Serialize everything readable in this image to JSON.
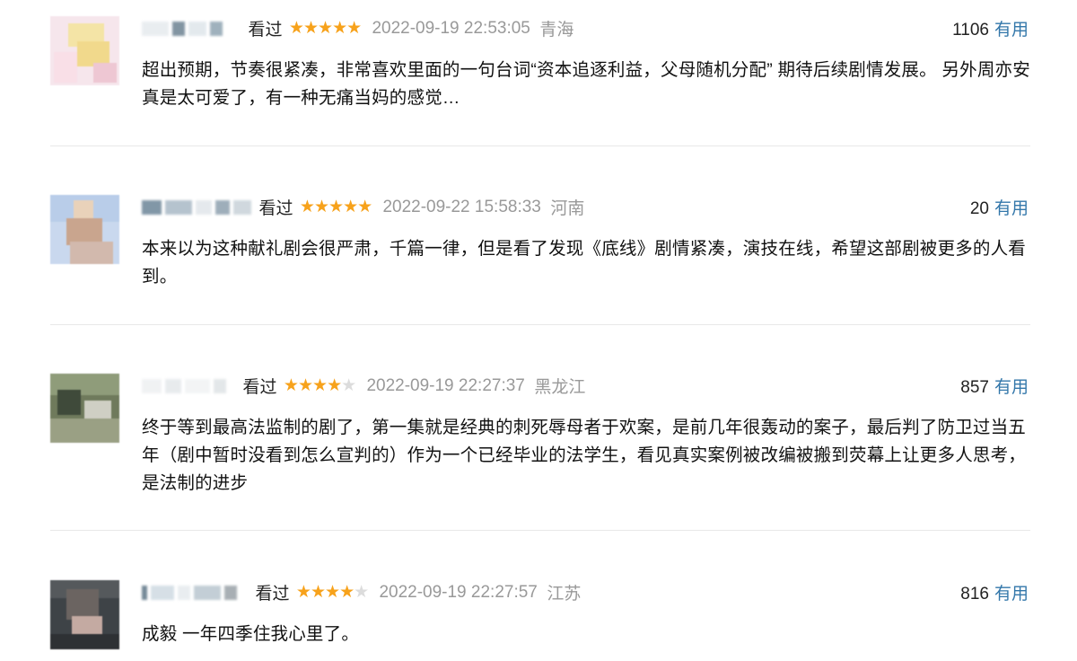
{
  "reviews": [
    {
      "status": "看过",
      "rating": 5,
      "time": "2022-09-19 22:53:05",
      "location": "青海",
      "useful_count": "1106",
      "useful_label": "有用",
      "content": "超出预期，节奏很紧凑，非常喜欢里面的一句台词“资本追逐利益，父母随机分配” 期待后续剧情发展。 另外周亦安真是太可爱了，有一种无痛当妈的感觉…"
    },
    {
      "status": "看过",
      "rating": 5,
      "time": "2022-09-22 15:58:33",
      "location": "河南",
      "useful_count": "20",
      "useful_label": "有用",
      "content": "本来以为这种献礼剧会很严肃，千篇一律，但是看了发现《底线》剧情紧凑，演技在线，希望这部剧被更多的人看到。"
    },
    {
      "status": "看过",
      "rating": 4,
      "time": "2022-09-19 22:27:37",
      "location": "黑龙江",
      "useful_count": "857",
      "useful_label": "有用",
      "content": "终于等到最高法监制的剧了，第一集就是经典的刺死辱母者于欢案，是前几年很轰动的案子，最后判了防卫过当五年（剧中暂时没看到怎么宣判的）作为一个已经毕业的法学生，看见真实案例被改编被搬到荧幕上让更多人思考，是法制的进步"
    },
    {
      "status": "看过",
      "rating": 4,
      "time": "2022-09-19 22:27:57",
      "location": "江苏",
      "useful_count": "816",
      "useful_label": "有用",
      "content": "成毅 一年四季住我心里了。"
    }
  ]
}
